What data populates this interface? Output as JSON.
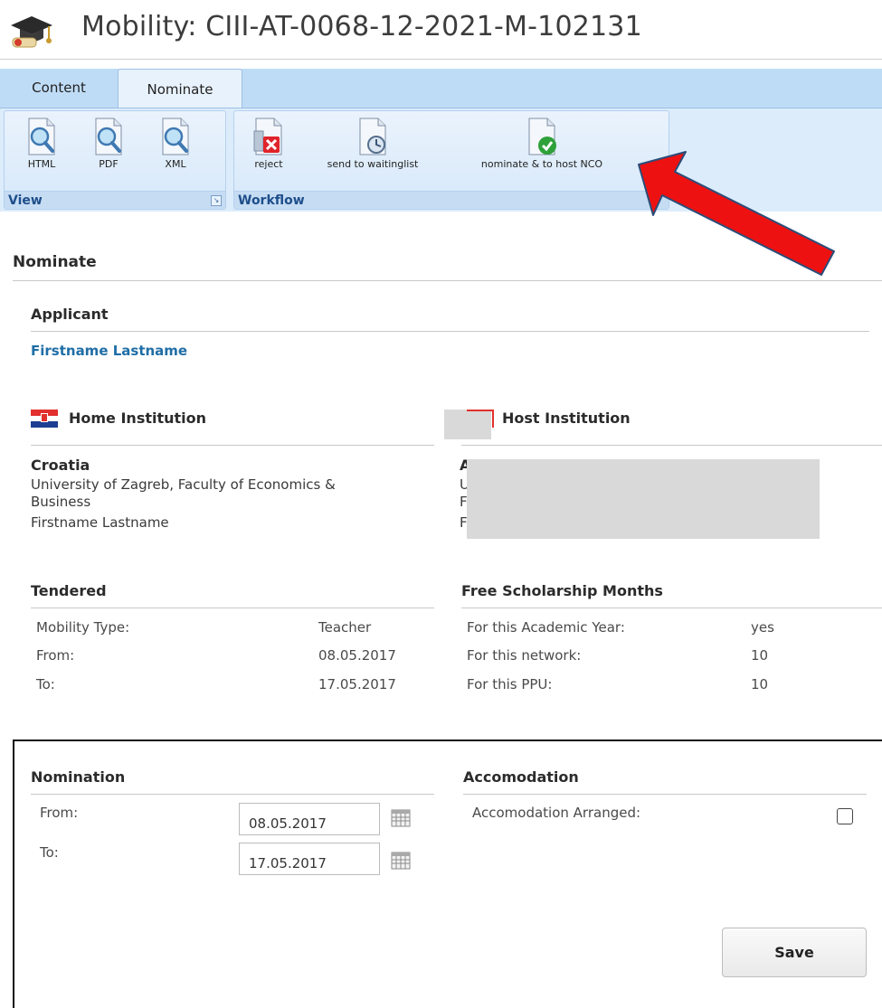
{
  "header": {
    "title": "Mobility: CIII-AT-0068-12-2021-M-102131",
    "icon": "graduation-cap-icon"
  },
  "ribbon": {
    "tabs": [
      {
        "label": "Content",
        "active": false
      },
      {
        "label": "Nominate",
        "active": true
      }
    ],
    "groups": {
      "view": {
        "label": "View",
        "buttons": [
          {
            "label": "HTML",
            "icon": "magnifier-doc-icon"
          },
          {
            "label": "PDF",
            "icon": "magnifier-doc-icon"
          },
          {
            "label": "XML",
            "icon": "magnifier-doc-icon"
          }
        ]
      },
      "workflow": {
        "label": "Workflow",
        "buttons": [
          {
            "label": "reject",
            "icon": "doc-reject-icon"
          },
          {
            "label": "send to waitinglist",
            "icon": "doc-clock-icon"
          },
          {
            "label": "nominate & to host NCO",
            "icon": "doc-check-icon"
          }
        ]
      }
    }
  },
  "page": {
    "section_title": "Nominate",
    "applicant": {
      "title": "Applicant",
      "name": "Firstname Lastname"
    },
    "home": {
      "title": "Home Institution",
      "country": "Croatia",
      "institution_line1": "University of Zagreb, Faculty of Economics &",
      "institution_line2": "Business",
      "person": "Firstname Lastname"
    },
    "host": {
      "title": "Host Institution",
      "country_partial": "Albania",
      "line1": "U",
      "line2": "F",
      "line3": "F"
    },
    "tendered": {
      "title": "Tendered",
      "rows": [
        {
          "label": "Mobility Type:",
          "value": "Teacher"
        },
        {
          "label": "From:",
          "value": "08.05.2017"
        },
        {
          "label": "To:",
          "value": "17.05.2017"
        }
      ]
    },
    "free_months": {
      "title": "Free Scholarship Months",
      "rows": [
        {
          "label": "For this Academic Year:",
          "value": "yes"
        },
        {
          "label": "For this network:",
          "value": "10"
        },
        {
          "label": "For this PPU:",
          "value": "10"
        }
      ]
    },
    "nomination": {
      "title": "Nomination",
      "from_label": "From:",
      "from_value": "08.05.2017",
      "to_label": "To:",
      "to_value": "17.05.2017"
    },
    "accomodation": {
      "title": "Accomodation",
      "arranged_label": "Accomodation Arranged:",
      "arranged_checked": false
    },
    "save_label": "Save"
  },
  "colors": {
    "link": "#1f6ea6",
    "ribbon_bg": "#bfdcf7",
    "annotation_arrow": "#ee1111"
  }
}
